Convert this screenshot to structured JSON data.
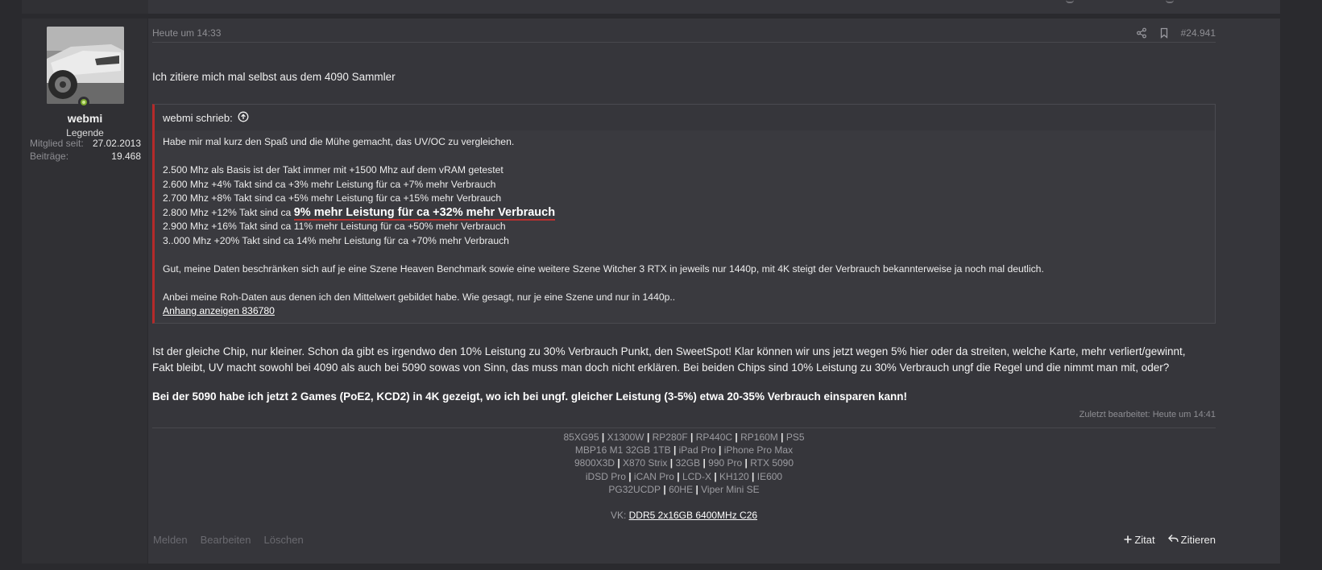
{
  "post": {
    "date": "Heute um 14:33",
    "number": "#24.941",
    "icons": [
      "share-icon",
      "bookmark-icon",
      "arrow-up-circle-icon",
      "plus-icon",
      "reply-icon"
    ]
  },
  "user": {
    "name": "webmi",
    "title": "Legende",
    "stats": [
      {
        "label": "Mitglied seit:",
        "value": "27.02.2013"
      },
      {
        "label": "Beiträge:",
        "value": "19.468"
      }
    ]
  },
  "intro": "Ich zitiere mich mal selbst aus dem 4090 Sammler",
  "quote": {
    "author": "webmi schrieb:",
    "line1": "Habe mir mal kurz den Spaß und die Mühe gemacht, das UV/OC zu vergleichen.",
    "line2": "2.500 Mhz als Basis ist der Takt immer mit +1500 Mhz auf dem vRAM getestet",
    "line3": "2.600 Mhz +4% Takt sind ca +3% mehr Leistung für ca +7% mehr Verbrauch",
    "line4": "2.700 Mhz +8% Takt sind ca +5% mehr Leistung für ca +15% mehr Verbrauch",
    "line5_prefix": "2.800 Mhz +12% Takt sind ca ",
    "line5_highlight": "9% mehr Leistung für ca +32% mehr Verbrauch",
    "line6": "2.900 Mhz +16% Takt sind ca 11% mehr Leistung für ca +50% mehr Verbrauch",
    "line7": "3..000 Mhz +20% Takt sind ca 14% mehr Leistung für ca +70% mehr Verbrauch",
    "line8": "Gut, meine Daten beschränken sich auf je eine Szene Heaven Benchmark sowie eine weitere Szene Witcher 3 RTX in jeweils nur 1440p, mit 4K steigt der Verbrauch bekannterweise ja noch mal deutlich.",
    "line9": "Anbei meine Roh-Daten aus denen ich den Mittelwert gebildet habe. Wie gesagt, nur je eine Szene und nur in 1440p..",
    "attachment": "Anhang anzeigen 836780"
  },
  "body": {
    "p1": "Ist der gleiche Chip, nur kleiner. Schon da gibt es irgendwo den 10% Leistung zu 30% Verbrauch Punkt, den SweetSpot! Klar können wir uns jetzt wegen 5% hier oder da streiten, welche Karte, mehr verliert/gewinnt, Fakt bleibt, UV macht sowohl bei 4090 als auch bei 5090 sowas von Sinn, das muss man doch nicht erklären. Bei beiden Chips sind 10% Leistung zu 30% Verbrauch ungf die Regel und die nimmt man mit, oder?",
    "p2": "Bei der 5090 habe ich jetzt 2 Games (PoE2, KCD2) in 4K gezeigt, wo ich bei ungf. gleicher Leistung (3-5%) etwa 20-35% Verbrauch einsparen kann!"
  },
  "edited": "Zuletzt bearbeitet: Heute um 14:41",
  "signature": {
    "row1": [
      "85XG95",
      "X1300W",
      "RP280F",
      "RP440C",
      "RP160M",
      "PS5"
    ],
    "row2": [
      "MBP16 M1 32GB 1TB",
      "iPad Pro",
      "iPhone Pro Max"
    ],
    "row3": [
      "9800X3D",
      "X870 Strix",
      "32GB",
      "990 Pro",
      "RTX 5090"
    ],
    "row4": [
      "iDSD Pro",
      "iCAN Pro",
      "LCD-X",
      "KH120",
      "IE600"
    ],
    "row5": [
      "PG32UCDP",
      "60HE",
      "Viper Mini SE"
    ],
    "vk_label": "VK: ",
    "vk_link": "DDR5 2x16GB 6400MHz C26",
    "separator": "|"
  },
  "actions": {
    "report": "Melden",
    "edit": "Bearbeiten",
    "delete": "Löschen",
    "quote_plus": "Zitat",
    "reply": "Zitieren"
  }
}
